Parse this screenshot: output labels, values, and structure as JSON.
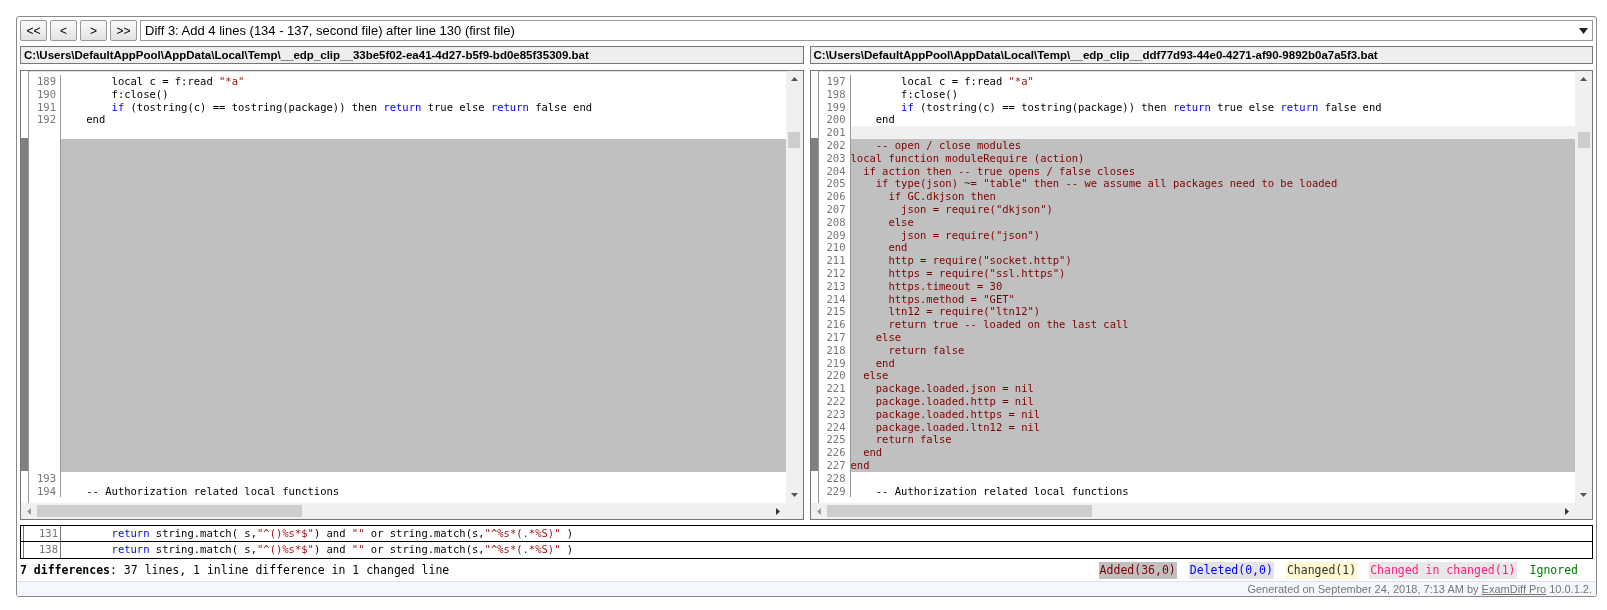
{
  "navigation": {
    "buttons": [
      "<<",
      "<",
      ">",
      ">>"
    ],
    "diff_selector": "Diff 3: Add 4 lines (134 - 137, second file) after line 130 (first file)"
  },
  "panes": [
    {
      "path": "C:\\Users\\DefaultAppPool\\AppData\\Local\\Temp\\__edp_clip__33be5f02-ea41-4d27-b5f9-bd0e85f35309.bat",
      "lines": [
        {
          "kind": "normal",
          "number": "189",
          "segments": [
            {
              "kind": "text",
              "text": "        local c = f:read "
            },
            {
              "kind": "string",
              "text": "\"*a\""
            }
          ]
        },
        {
          "kind": "normal",
          "number": "190",
          "segments": [
            {
              "kind": "text",
              "text": "        f:close()"
            }
          ]
        },
        {
          "kind": "normal",
          "number": "191",
          "segments": [
            {
              "kind": "keyword",
              "text": "        if"
            },
            {
              "kind": "text",
              "text": " (tostring(c) == tostring(package)) then "
            },
            {
              "kind": "keyword",
              "text": "return"
            },
            {
              "kind": "text",
              "text": " true else "
            },
            {
              "kind": "keyword",
              "text": "return"
            },
            {
              "kind": "text",
              "text": " false end"
            }
          ]
        },
        {
          "kind": "normal",
          "number": "192",
          "segments": [
            {
              "kind": "text",
              "text": "    end"
            }
          ]
        },
        {
          "kind": "blank"
        },
        {
          "kind": "filler"
        },
        {
          "kind": "filler"
        },
        {
          "kind": "filler"
        },
        {
          "kind": "filler"
        },
        {
          "kind": "filler"
        },
        {
          "kind": "filler"
        },
        {
          "kind": "filler"
        },
        {
          "kind": "filler"
        },
        {
          "kind": "filler"
        },
        {
          "kind": "filler"
        },
        {
          "kind": "filler"
        },
        {
          "kind": "filler"
        },
        {
          "kind": "filler"
        },
        {
          "kind": "filler"
        },
        {
          "kind": "filler"
        },
        {
          "kind": "filler"
        },
        {
          "kind": "filler"
        },
        {
          "kind": "filler"
        },
        {
          "kind": "filler"
        },
        {
          "kind": "filler"
        },
        {
          "kind": "filler"
        },
        {
          "kind": "filler"
        },
        {
          "kind": "filler"
        },
        {
          "kind": "filler"
        },
        {
          "kind": "filler"
        },
        {
          "kind": "filler"
        },
        {
          "kind": "normal",
          "number": "193"
        },
        {
          "kind": "normal",
          "number": "194",
          "segments": [
            {
              "kind": "text",
              "text": "    -- Authorization related local functions"
            }
          ]
        }
      ]
    },
    {
      "path": "C:\\Users\\DefaultAppPool\\AppData\\Local\\Temp\\__edp_clip__ddf77d93-44e0-4271-af90-9892b0a7a5f3.bat",
      "lines": [
        {
          "kind": "normal",
          "number": "197",
          "segments": [
            {
              "kind": "text",
              "text": "        local c = f:read "
            },
            {
              "kind": "string",
              "text": "\"*a\""
            }
          ]
        },
        {
          "kind": "normal",
          "number": "198",
          "segments": [
            {
              "kind": "text",
              "text": "        f:close()"
            }
          ]
        },
        {
          "kind": "normal",
          "number": "199",
          "segments": [
            {
              "kind": "keyword",
              "text": "        if"
            },
            {
              "kind": "text",
              "text": " (tostring(c) == tostring(package)) then "
            },
            {
              "kind": "keyword",
              "text": "return"
            },
            {
              "kind": "text",
              "text": " true else "
            },
            {
              "kind": "keyword",
              "text": "return"
            },
            {
              "kind": "text",
              "text": " false end"
            }
          ]
        },
        {
          "kind": "normal",
          "number": "200",
          "segments": [
            {
              "kind": "text",
              "text": "    end"
            }
          ]
        },
        {
          "kind": "current",
          "number": "201"
        },
        {
          "kind": "added",
          "number": "202",
          "segments": [
            {
              "kind": "text",
              "text": "    -- open / close modules"
            }
          ]
        },
        {
          "kind": "added",
          "number": "203",
          "segments": [
            {
              "kind": "text",
              "text": "local function moduleRequire (action)"
            }
          ]
        },
        {
          "kind": "added",
          "number": "204",
          "segments": [
            {
              "kind": "text",
              "text": "  if action then -- true opens / false closes"
            }
          ]
        },
        {
          "kind": "added",
          "number": "205",
          "segments": [
            {
              "kind": "text",
              "text": "    if type(json) ~= \"table\" then -- we assume all packages need to be loaded"
            }
          ]
        },
        {
          "kind": "added",
          "number": "206",
          "segments": [
            {
              "kind": "text",
              "text": "      if GC.dkjson then"
            }
          ]
        },
        {
          "kind": "added",
          "number": "207",
          "segments": [
            {
              "kind": "text",
              "text": "        json = require(\"dkjson\")"
            }
          ]
        },
        {
          "kind": "added",
          "number": "208",
          "segments": [
            {
              "kind": "text",
              "text": "      else"
            }
          ]
        },
        {
          "kind": "added",
          "number": "209",
          "segments": [
            {
              "kind": "text",
              "text": "        json = require(\"json\")"
            }
          ]
        },
        {
          "kind": "added",
          "number": "210",
          "segments": [
            {
              "kind": "text",
              "text": "      end"
            }
          ]
        },
        {
          "kind": "added",
          "number": "211",
          "segments": [
            {
              "kind": "text",
              "text": "      http = require(\"socket.http\")"
            }
          ]
        },
        {
          "kind": "added",
          "number": "212",
          "segments": [
            {
              "kind": "text",
              "text": "      https = require(\"ssl.https\")"
            }
          ]
        },
        {
          "kind": "added",
          "number": "213",
          "segments": [
            {
              "kind": "text",
              "text": "      https.timeout = 30"
            }
          ]
        },
        {
          "kind": "added",
          "number": "214",
          "segments": [
            {
              "kind": "text",
              "text": "      https.method = \"GET\""
            }
          ]
        },
        {
          "kind": "added",
          "number": "215",
          "segments": [
            {
              "kind": "text",
              "text": "      ltn12 = require(\"ltn12\")"
            }
          ]
        },
        {
          "kind": "added",
          "number": "216",
          "segments": [
            {
              "kind": "text",
              "text": "      return true -- loaded on the last call"
            }
          ]
        },
        {
          "kind": "added",
          "number": "217",
          "segments": [
            {
              "kind": "text",
              "text": "    else"
            }
          ]
        },
        {
          "kind": "added",
          "number": "218",
          "segments": [
            {
              "kind": "text",
              "text": "      return false"
            }
          ]
        },
        {
          "kind": "added",
          "number": "219",
          "segments": [
            {
              "kind": "text",
              "text": "    end"
            }
          ]
        },
        {
          "kind": "added",
          "number": "220",
          "segments": [
            {
              "kind": "text",
              "text": "  else"
            }
          ]
        },
        {
          "kind": "added",
          "number": "221",
          "segments": [
            {
              "kind": "text",
              "text": "    package.loaded.json = nil"
            }
          ]
        },
        {
          "kind": "added",
          "number": "222",
          "segments": [
            {
              "kind": "text",
              "text": "    package.loaded.http = nil"
            }
          ]
        },
        {
          "kind": "added",
          "number": "223",
          "segments": [
            {
              "kind": "text",
              "text": "    package.loaded.https = nil"
            }
          ]
        },
        {
          "kind": "added",
          "number": "224",
          "segments": [
            {
              "kind": "text",
              "text": "    package.loaded.ltn12 = nil"
            }
          ]
        },
        {
          "kind": "added",
          "number": "225",
          "segments": [
            {
              "kind": "text",
              "text": "    return false"
            }
          ]
        },
        {
          "kind": "added",
          "number": "226",
          "segments": [
            {
              "kind": "text",
              "text": "  end"
            }
          ]
        },
        {
          "kind": "added",
          "number": "227",
          "segments": [
            {
              "kind": "text",
              "text": "end"
            }
          ]
        },
        {
          "kind": "normal",
          "number": "228"
        },
        {
          "kind": "normal",
          "number": "229",
          "segments": [
            {
              "kind": "text",
              "text": "    -- Authorization related local functions"
            }
          ]
        }
      ]
    }
  ],
  "compare_lines": [
    {
      "number": "131",
      "segments": [
        {
          "kind": "keyword",
          "text": "        return"
        },
        {
          "kind": "text",
          "text": " string.match( s,"
        },
        {
          "kind": "string",
          "text": "\"^()%s*$\""
        },
        {
          "kind": "text",
          "text": ") and "
        },
        {
          "kind": "string",
          "text": "\"\""
        },
        {
          "kind": "text",
          "text": " or string.match(s,"
        },
        {
          "kind": "string",
          "text": "\"^%s*(.*%S)\""
        },
        {
          "kind": "text",
          "text": " )"
        }
      ]
    },
    {
      "number": "138",
      "segments": [
        {
          "kind": "keyword",
          "text": "        return"
        },
        {
          "kind": "text",
          "text": " string.match( s,"
        },
        {
          "kind": "string",
          "text": "\"^()%s*$\""
        },
        {
          "kind": "text",
          "text": ") and "
        },
        {
          "kind": "string",
          "text": "\"\""
        },
        {
          "kind": "text",
          "text": " or string.match(s,"
        },
        {
          "kind": "string",
          "text": "\"^%s*(.*%S)\""
        },
        {
          "kind": "text",
          "text": " )"
        }
      ]
    }
  ],
  "status": {
    "summary": "**7 differences**: 37 lines, 1 inline difference in 1 changed line",
    "legend": [
      {
        "kind": "added",
        "label": "Added(36,0)"
      },
      {
        "kind": "deleted",
        "label": "Deleted(0,0)"
      },
      {
        "kind": "changed",
        "label": "Changed(1)"
      },
      {
        "kind": "changed_in_changed",
        "label": "Changed in changed(1)"
      },
      {
        "kind": "ignored",
        "label": "Ignored"
      }
    ]
  },
  "footer": {
    "prefix": "Generated on September 24, 2018, 7:13 AM by",
    "link": "ExamDiff Pro",
    "suffix": "10.0.1.2."
  }
}
